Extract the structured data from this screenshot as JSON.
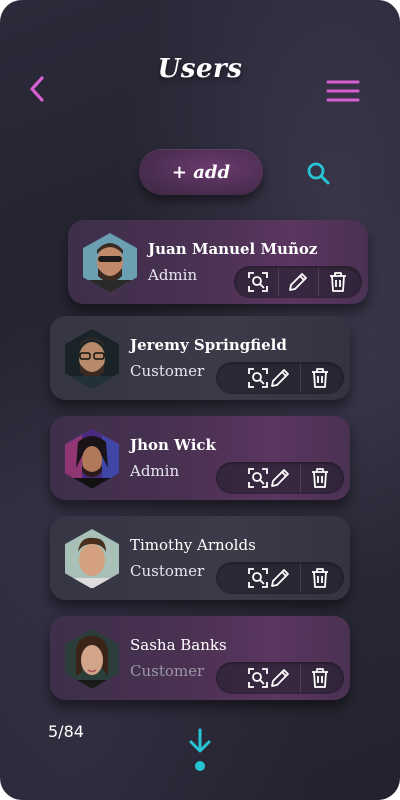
{
  "header": {
    "title": "Users",
    "back_icon": "chevron-left-icon",
    "menu_icon": "hamburger-menu-icon"
  },
  "toolbar": {
    "add_label": "+ add",
    "search_icon": "search-icon"
  },
  "users": [
    {
      "name": "Juan Manuel Muñoz",
      "role": "Admin",
      "avatar": "avatar-juan"
    },
    {
      "name": "Jeremy Springfield",
      "role": "Customer",
      "avatar": "avatar-jeremy"
    },
    {
      "name": "Jhon Wick",
      "role": "Admin",
      "avatar": "avatar-jhon"
    },
    {
      "name": "Timothy Arnolds",
      "role": "Customer",
      "avatar": "avatar-timothy"
    },
    {
      "name": "Sasha Banks",
      "role": "Customer",
      "avatar": "avatar-sasha"
    }
  ],
  "actions": {
    "view_icon": "scan-view-icon",
    "edit_icon": "pencil-edit-icon",
    "delete_icon": "trash-icon"
  },
  "footer": {
    "page_count": "5/84",
    "download_icon": "download-arrow-icon"
  },
  "colors": {
    "accent_pink": "#d45fd0",
    "accent_cyan": "#27c4d4",
    "background": "#25242f"
  }
}
